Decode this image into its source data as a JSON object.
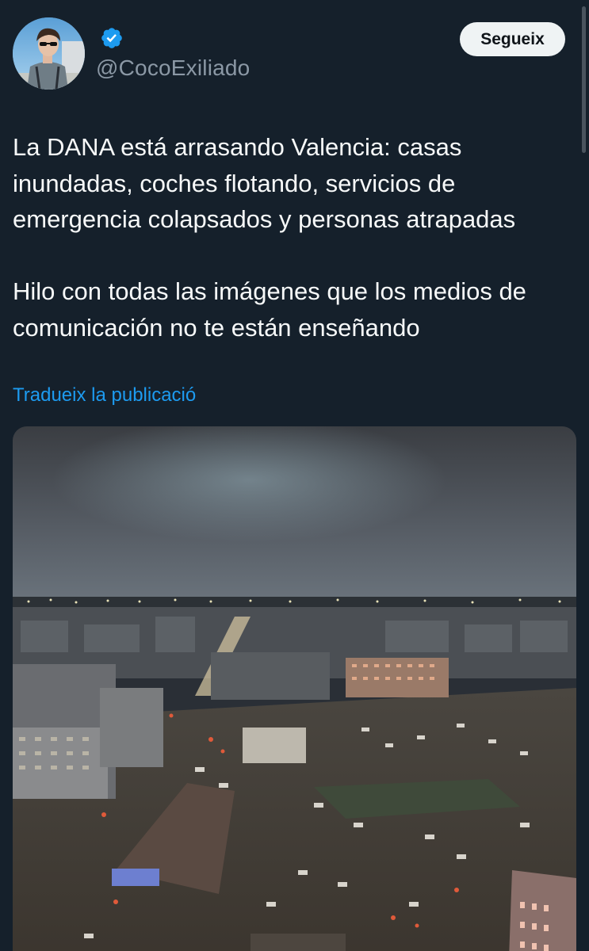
{
  "tweet": {
    "handle": "@CocoExiliado",
    "follow_label": "Segueix",
    "text_paragraph_1": "La DANA está arrasando Valencia: casas inundadas, coches flotando, servicios de emergencia colapsados y personas atrapadas",
    "text_paragraph_2": "Hilo con todas las imágenes que los medios de comunicación no te están enseñando",
    "translate_label": "Tradueix la publicació"
  },
  "colors": {
    "background": "#15202b",
    "text": "#f7f9f9",
    "muted": "#8b98a5",
    "link": "#1d9bf0",
    "verified_badge": "#1d9bf0",
    "follow_button_bg": "#eff3f4"
  },
  "icons": {
    "verified": "verified-badge-icon"
  }
}
